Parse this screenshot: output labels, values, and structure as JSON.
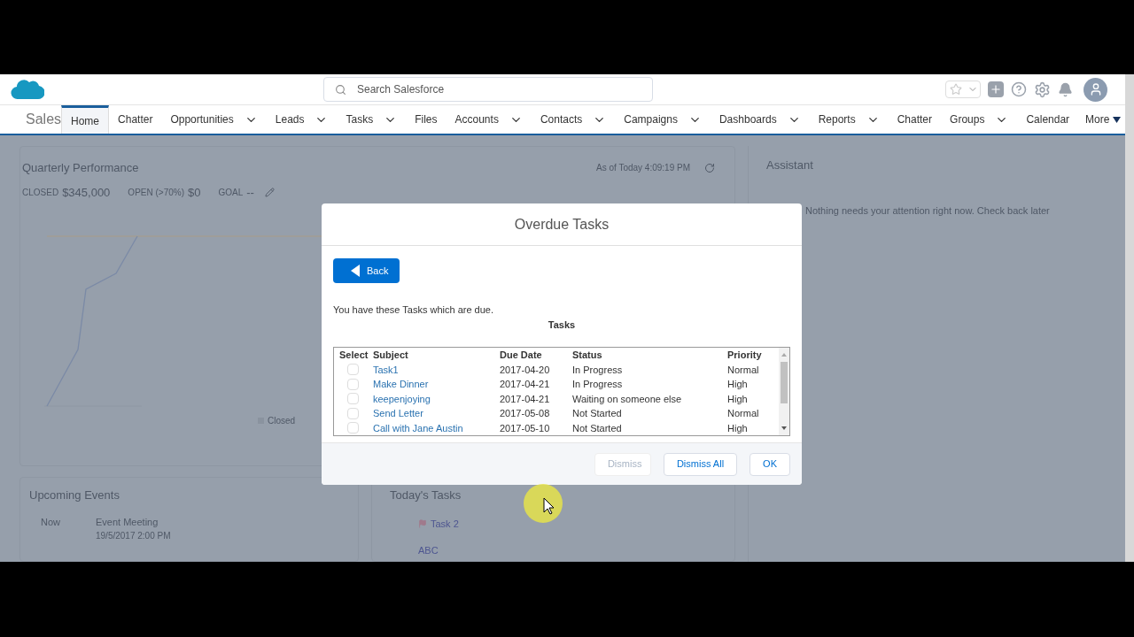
{
  "header": {
    "search": {
      "placeholder": "Search Salesforce"
    }
  },
  "nav": {
    "app_name": "Sales",
    "items": [
      {
        "label": "Home",
        "selected": true,
        "dropdown": false
      },
      {
        "label": "Chatter",
        "selected": false,
        "dropdown": false
      },
      {
        "label": "Opportunities",
        "selected": false,
        "dropdown": true
      },
      {
        "label": "Leads",
        "selected": false,
        "dropdown": true
      },
      {
        "label": "Tasks",
        "selected": false,
        "dropdown": true
      },
      {
        "label": "Files",
        "selected": false,
        "dropdown": false
      },
      {
        "label": "Accounts",
        "selected": false,
        "dropdown": true
      },
      {
        "label": "Contacts",
        "selected": false,
        "dropdown": true
      },
      {
        "label": "Campaigns",
        "selected": false,
        "dropdown": true
      },
      {
        "label": "Dashboards",
        "selected": false,
        "dropdown": true
      },
      {
        "label": "Reports",
        "selected": false,
        "dropdown": true
      },
      {
        "label": "Chatter",
        "selected": false,
        "dropdown": false
      },
      {
        "label": "Groups",
        "selected": false,
        "dropdown": true
      },
      {
        "label": "Calendar",
        "selected": false,
        "dropdown": false
      }
    ],
    "more": "More"
  },
  "performance": {
    "title": "Quarterly Performance",
    "as_of": "As of Today 4:09:19 PM",
    "stats": [
      {
        "label": "CLOSED",
        "value": "$345,000"
      },
      {
        "label": "OPEN (>70%)",
        "value": "$0"
      },
      {
        "label": "GOAL",
        "value": "--"
      }
    ],
    "legend": "Closed"
  },
  "upcoming_events": {
    "title": "Upcoming Events",
    "items": [
      {
        "when": "Now",
        "name": "Event Meeting",
        "date": "19/5/2017 2:00 PM"
      }
    ]
  },
  "todays_tasks": {
    "title": "Today's Tasks",
    "items": [
      "Task 2",
      "ABC"
    ]
  },
  "assistant": {
    "title": "Assistant",
    "message": "Nothing needs your attention right now. Check back later"
  },
  "modal": {
    "title": "Overdue Tasks",
    "back": "Back",
    "intro": "You have these Tasks which are due.",
    "table_title": "Tasks",
    "columns": [
      "Select",
      "Subject",
      "Due Date",
      "Status",
      "Priority"
    ],
    "rows": [
      {
        "checked": false,
        "subject": "Task1",
        "due": "2017-04-20",
        "status": "In Progress",
        "priority": "Normal"
      },
      {
        "checked": false,
        "subject": "Make Dinner",
        "due": "2017-04-21",
        "status": "In Progress",
        "priority": "High"
      },
      {
        "checked": false,
        "subject": "keepenjoying",
        "due": "2017-04-21",
        "status": "Waiting on someone else",
        "priority": "High"
      },
      {
        "checked": false,
        "subject": "Send Letter",
        "due": "2017-05-08",
        "status": "Not Started",
        "priority": "Normal"
      },
      {
        "checked": false,
        "subject": "Call with Jane Austin",
        "due": "2017-05-10",
        "status": "Not Started",
        "priority": "High"
      }
    ],
    "buttons": [
      {
        "label": "Dismiss",
        "disabled": true
      },
      {
        "label": "Dismiss All",
        "disabled": false
      },
      {
        "label": "OK",
        "disabled": false
      }
    ]
  }
}
